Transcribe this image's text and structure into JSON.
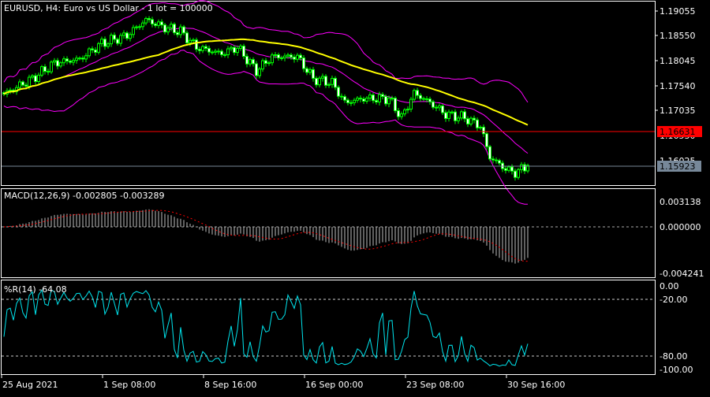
{
  "main": {
    "title": "EURUSD, H4:  Euro vs US Dollar - 1 lot = 100000",
    "price_labels": [
      "1.19055",
      "1.18550",
      "1.18045",
      "1.17540",
      "1.17035",
      "1.16530",
      "1.16025"
    ],
    "ask_label": "1.16631",
    "bid_label": "1.15923",
    "colors": {
      "candle": "#00ff00",
      "bands": "#ff00ff",
      "ma": "#ffff00",
      "ask": "#ff0000",
      "bid": "#778899"
    }
  },
  "macd": {
    "title": "MACD(12,26,9) -0.002805 -0.003289",
    "labels": [
      "0.003138",
      "0.000000",
      "-0.004241"
    ]
  },
  "wpr": {
    "title": "%R(14) -64.08",
    "labels": [
      "0.00",
      "-20.00",
      "-80.00",
      "-100.00"
    ],
    "line_color": "#00e5ee"
  },
  "x_axis": [
    "25 Aug 2021",
    "1 Sep 08:00",
    "8 Sep 16:00",
    "16 Sep 00:00",
    "23 Sep 08:00",
    "30 Sep 16:00"
  ],
  "chart_data": {
    "type": "candlestick",
    "symbol": "EURUSD",
    "timeframe": "H4",
    "ylim": [
      1.156,
      1.192
    ],
    "key_closes": [
      {
        "bar": 0,
        "close": 1.1737
      },
      {
        "bar": 9,
        "close": 1.1768
      },
      {
        "bar": 16,
        "close": 1.18
      },
      {
        "bar": 24,
        "close": 1.1808
      },
      {
        "bar": 31,
        "close": 1.184
      },
      {
        "bar": 39,
        "close": 1.1856
      },
      {
        "bar": 45,
        "close": 1.1888
      },
      {
        "bar": 51,
        "close": 1.1872
      },
      {
        "bar": 56,
        "close": 1.1864
      },
      {
        "bar": 61,
        "close": 1.1832
      },
      {
        "bar": 69,
        "close": 1.1819
      },
      {
        "bar": 74,
        "close": 1.1832
      },
      {
        "bar": 80,
        "close": 1.1784
      },
      {
        "bar": 85,
        "close": 1.1813
      },
      {
        "bar": 93,
        "close": 1.1813
      },
      {
        "bar": 98,
        "close": 1.1768
      },
      {
        "bar": 104,
        "close": 1.176
      },
      {
        "bar": 108,
        "close": 1.172
      },
      {
        "bar": 114,
        "close": 1.1728
      },
      {
        "bar": 122,
        "close": 1.1728
      },
      {
        "bar": 126,
        "close": 1.1689
      },
      {
        "bar": 130,
        "close": 1.1739
      },
      {
        "bar": 135,
        "close": 1.172
      },
      {
        "bar": 140,
        "close": 1.1696
      },
      {
        "bar": 146,
        "close": 1.1689
      },
      {
        "bar": 151,
        "close": 1.1672
      },
      {
        "bar": 154,
        "close": 1.1609
      },
      {
        "bar": 159,
        "close": 1.1585
      },
      {
        "bar": 162,
        "close": 1.1577
      },
      {
        "bar": 166,
        "close": 1.15923
      }
    ],
    "ask": 1.16631,
    "bid": 1.15923,
    "macd": {
      "main": -0.002805,
      "signal": -0.003289,
      "ylim": [
        -0.004241,
        0.003138
      ]
    },
    "wpr": {
      "value": -64.08,
      "levels": [
        -20,
        -80
      ],
      "ylim": [
        -100,
        0
      ]
    }
  }
}
